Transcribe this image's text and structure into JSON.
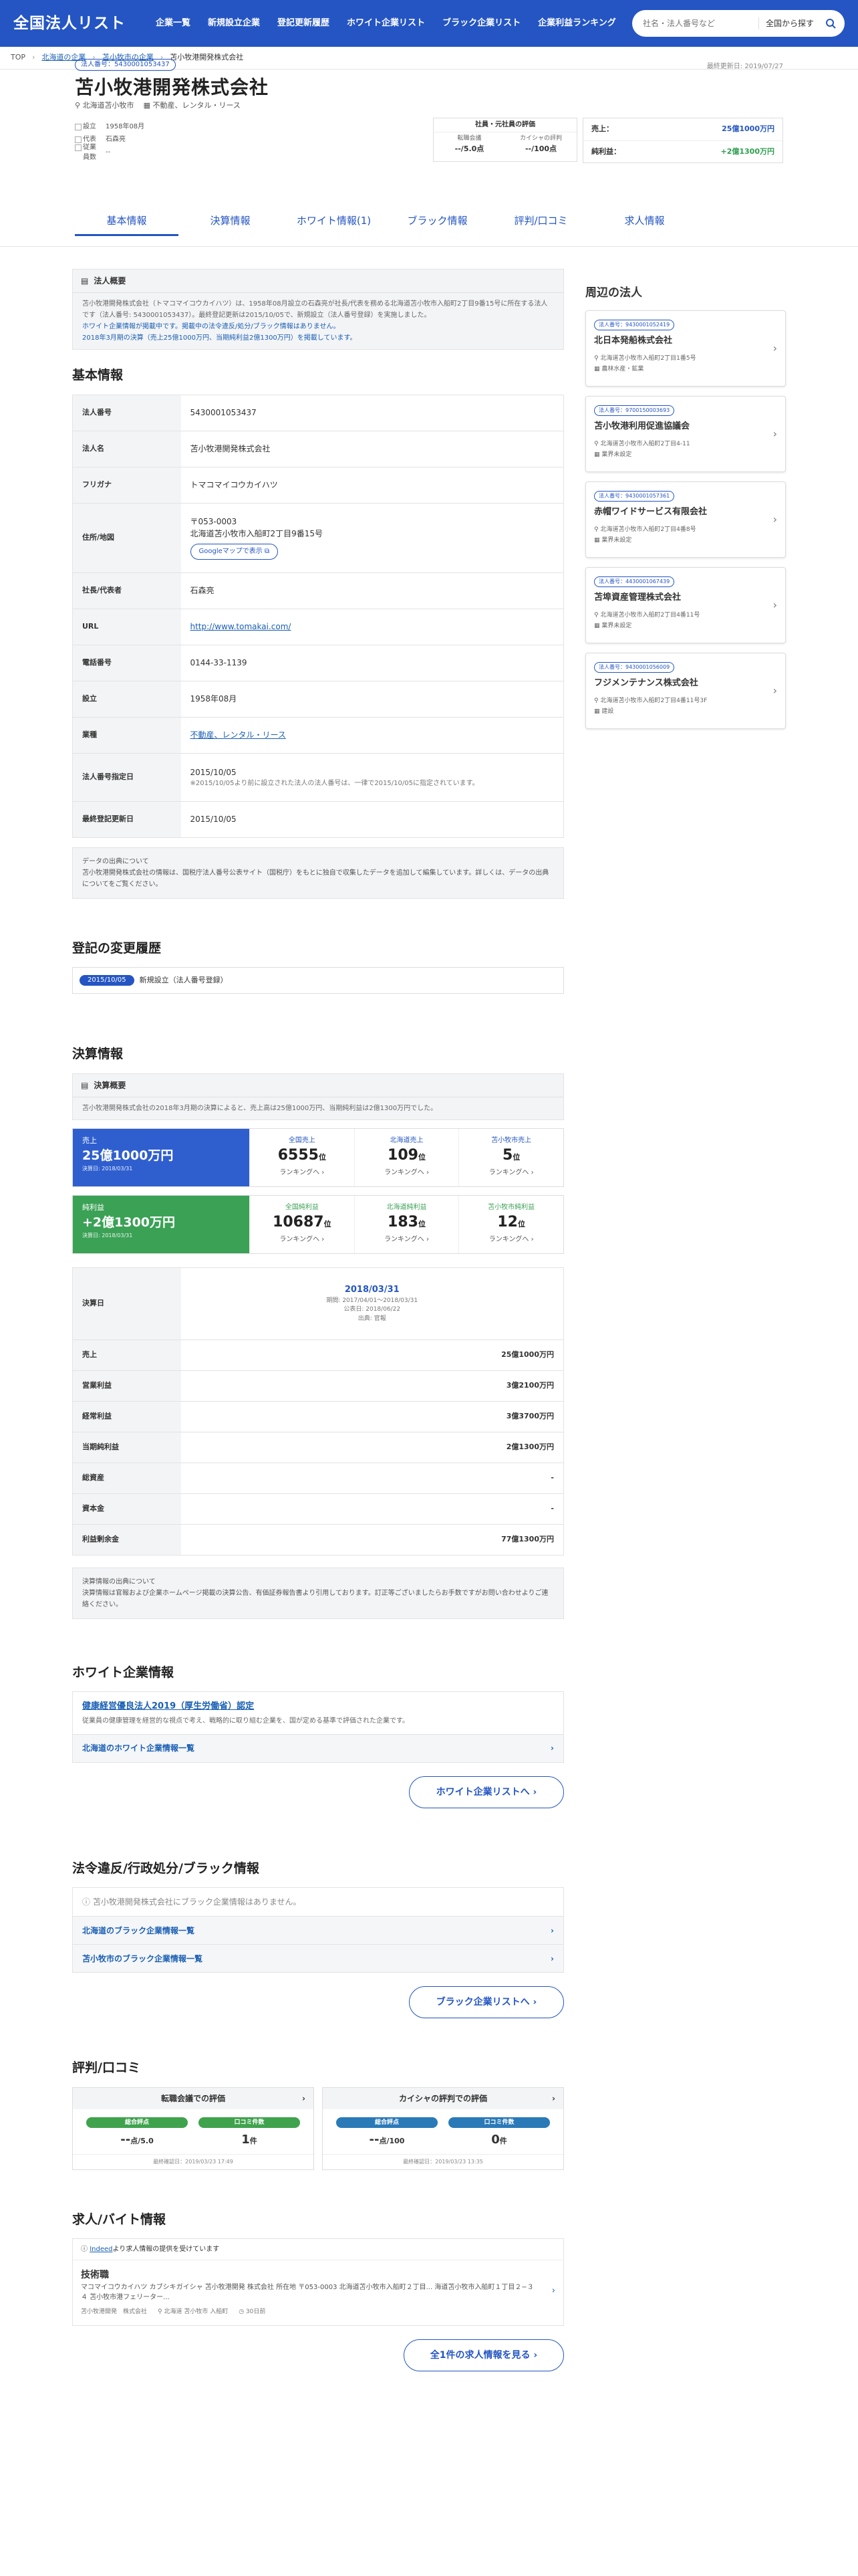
{
  "header": {
    "logo": "全国法人リスト",
    "nav": [
      "企業一覧",
      "新規設立企業",
      "登記更新履歴",
      "ホワイト企業リスト",
      "ブラック企業リスト",
      "企業利益ランキング"
    ],
    "search_placeholder": "社名・法人番号など",
    "search_scope": "全国から探す"
  },
  "breadcrumb": [
    "TOP",
    "北海道の企業",
    "苫小牧市の企業",
    "苫小牧港開発株式会社"
  ],
  "company": {
    "corp_no_badge": "法人番号：5430001053437",
    "updated": "最終更新日: 2019/07/27",
    "name": "苫小牧港開発株式会社",
    "location": "北海道苫小牧市",
    "industry": "不動産、レンタル・リース",
    "facts": [
      {
        "k": "設立",
        "v": "1958年08月"
      },
      {
        "k": "代表",
        "v": "石森亮"
      },
      {
        "k": "従業員数",
        "v": "--"
      }
    ],
    "hyoka_title": "社員・元社員の評価",
    "hyoka": [
      {
        "k": "転職会議",
        "v": "--/5.0点"
      },
      {
        "k": "カイシャの評判",
        "v": "--/100点"
      }
    ],
    "sales_label": "売上：",
    "sales": "25億1000万円",
    "profit_label": "純利益：",
    "profit": "+2億1300万円"
  },
  "tabs": [
    "基本情報",
    "決算情報",
    "ホワイト情報(1)",
    "ブラック情報",
    "評判/口コミ",
    "求人情報"
  ],
  "overview": {
    "title": "法人概要",
    "body": "苫小牧港開発株式会社（トマコマイコウカイハツ）は、1958年08月設立の石森亮が社長/代表を務める北海道苫小牧市入船町2丁目9番15号に所在する法人です（法人番号: 5430001053437）。最終登記更新は2015/10/05で、新規設立（法人番号登録）を実施しました。",
    "body2": "ホワイト企業情報が掲載中です。掲載中の法令違反/処分/ブラック情報はありません。",
    "body3": "2018年3月期の決算（売上25億1000万円、当期純利益2億1300万円）を掲載しています。"
  },
  "basic": {
    "heading": "基本情報",
    "rows": [
      {
        "k": "法人番号",
        "v": "5430001053437"
      },
      {
        "k": "法人名",
        "v": "苫小牧港開発株式会社"
      },
      {
        "k": "フリガナ",
        "v": "トマコマイコウカイハツ"
      },
      {
        "k": "住所/地図",
        "v": "〒053-0003",
        "v2": "北海道苫小牧市入船町2丁目9番15号",
        "btn": "Googleマップで表示"
      },
      {
        "k": "社長/代表者",
        "v": "石森亮"
      },
      {
        "k": "URL",
        "v": "http://www.tomakai.com/"
      },
      {
        "k": "電話番号",
        "v": "0144-33-1139"
      },
      {
        "k": "設立",
        "v": "1958年08月"
      },
      {
        "k": "業種",
        "v": "不動産、レンタル・リース"
      },
      {
        "k": "法人番号指定日",
        "v": "2015/10/05",
        "v2": "※2015/10/05より前に設立された法人の法人番号は、一律で2015/10/05に指定されています。"
      },
      {
        "k": "最終登記更新日",
        "v": "2015/10/05"
      }
    ],
    "note_title": "データの出典について",
    "note": "苫小牧港開発株式会社の情報は、国税庁法人番号公表サイト（国税庁）をもとに独自で収集したデータを追加して編集しています。詳しくは、データの出典についてをご覧ください。"
  },
  "history": {
    "heading": "登記の変更履歴",
    "date": "2015/10/05",
    "text": "新規設立（法人番号登録）"
  },
  "kessan": {
    "heading": "決算情報",
    "sum_title": "決算概要",
    "sum": "苫小牧港開発株式会社の2018年3月期の決算によると、売上高は25億1000万円、当期純利益は2億1300万円でした。",
    "sales": {
      "label": "売上",
      "value": "25億1000万円",
      "date": "決算日: 2018/03/31",
      "ranks": [
        {
          "t": "全国売上",
          "n": "6555",
          "u": "位"
        },
        {
          "t": "北海道売上",
          "n": "109",
          "u": "位"
        },
        {
          "t": "苫小牧市売上",
          "n": "5",
          "u": "位"
        }
      ]
    },
    "profit": {
      "label": "純利益",
      "value": "+2億1300万円",
      "date": "決算日: 2018/03/31",
      "ranks": [
        {
          "t": "全国純利益",
          "n": "10687",
          "u": "位"
        },
        {
          "t": "北海道純利益",
          "n": "183",
          "u": "位"
        },
        {
          "t": "苫小牧市純利益",
          "n": "12",
          "u": "位"
        }
      ]
    },
    "rank_link": "ランキングへ ›",
    "table_head": {
      "k": "決算日",
      "date": "2018/03/31",
      "p1": "期間: 2017/04/01〜2018/03/31",
      "p2": "公表日: 2018/06/22",
      "p3": "出典: 官報"
    },
    "rows": [
      {
        "k": "売上",
        "v": "25億1000万円"
      },
      {
        "k": "営業利益",
        "v": "3億2100万円"
      },
      {
        "k": "経常利益",
        "v": "3億3700万円"
      },
      {
        "k": "当期純利益",
        "v": "2億1300万円"
      },
      {
        "k": "総資産",
        "v": "-"
      },
      {
        "k": "資本金",
        "v": "-"
      },
      {
        "k": "利益剰余金",
        "v": "77億1300万円"
      }
    ],
    "note_title": "決算情報の出典について",
    "note": "決算情報は官報および企業ホームページ掲載の決算公告、有価証券報告書より引用しております。訂正等ございましたらお手数ですがお問い合わせよりご連絡ください。"
  },
  "white": {
    "heading": "ホワイト企業情報",
    "title": "健康経営優良法人2019（厚生労働省）認定",
    "desc": "従業員の健康管理を経営的な視点で考え、戦略的に取り組む企業を、国が定める基準で評価された企業です。",
    "link": "北海道のホワイト企業情報一覧",
    "btn": "ホワイト企業リストへ ›"
  },
  "black": {
    "heading": "法令違反/行政処分/ブラック情報",
    "none": "苫小牧港開発株式会社にブラック企業情報はありません。",
    "links": [
      "北海道のブラック企業情報一覧",
      "苫小牧市のブラック企業情報一覧"
    ],
    "btn": "ブラック企業リストへ ›"
  },
  "review": {
    "heading": "評判/口コミ",
    "cards": [
      {
        "t": "転職会議での評価",
        "a": "総合評点",
        "av": "--",
        "au": "点/5.0",
        "b": "口コミ件数",
        "bv": "1",
        "bu": "件",
        "f": "最終確認日：2019/03/23 17:49",
        "c": "#3fa34d"
      },
      {
        "t": "カイシャの評判での評価",
        "a": "総合評点",
        "av": "--",
        "au": "点/100",
        "b": "口コミ件数",
        "bv": "0",
        "bu": "件",
        "f": "最終確認日：2019/03/23 13:35",
        "c": "#2a7ab8"
      }
    ]
  },
  "job": {
    "heading": "求人/バイト情報",
    "indeed": "より求人情報の提供を受けています",
    "title": "技術職",
    "desc": "マコマイコウカイハツ カブシキガイシャ 苫小牧港開発 株式会社 所在地 〒053-0003 北海道苫小牧市入船町２丁目... 海道苫小牧市入船町１丁目２−３４ 苫小牧市港フェリーター...",
    "company": "苫小牧港開発　株式会社",
    "loc": "北海道 苫小牧市 入船町",
    "days": "30日前",
    "btn": "全1件の求人情報を見る ›"
  },
  "side": {
    "heading": "周辺の法人",
    "items": [
      {
        "no": "法人番号：9430001052419",
        "name": "北日本発船株式会社",
        "addr": "北海道苫小牧市入船町2丁目1番5号",
        "ind": "農林水産・鉱業"
      },
      {
        "no": "法人番号：9700150003693",
        "name": "苫小牧港利用促進協議会",
        "addr": "北海道苫小牧市入船町2丁目4-11",
        "ind": "業界未設定"
      },
      {
        "no": "法人番号：9430001057361",
        "name": "赤帽ワイドサービス有限会社",
        "addr": "北海道苫小牧市入船町2丁目4番8号",
        "ind": "業界未設定"
      },
      {
        "no": "法人番号：4430001067439",
        "name": "苫埠資産管理株式会社",
        "addr": "北海道苫小牧市入船町2丁目4番11号",
        "ind": "業界未設定"
      },
      {
        "no": "法人番号：9430001056009",
        "name": "フジメンテナンス株式会社",
        "addr": "北海道苫小牧市入船町2丁目4番11号3F",
        "ind": "建設"
      }
    ]
  }
}
